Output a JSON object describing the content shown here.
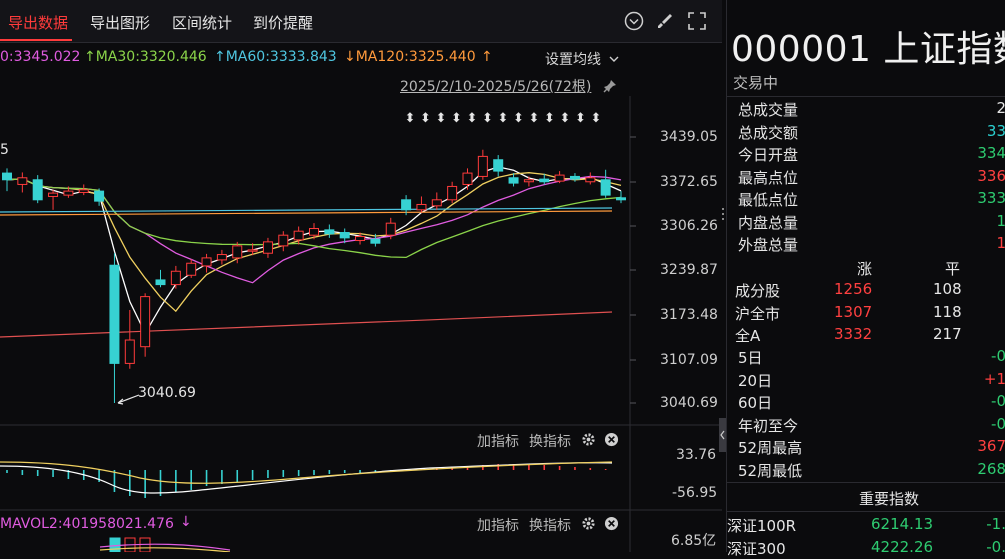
{
  "toolbar": {
    "tabs": [
      "导出数据",
      "导出图形",
      "区间统计",
      "到价提醒"
    ]
  },
  "ma_bar": {
    "ma_first": "0:3345.022",
    "ma30": "↑MA30:3320.446",
    "ma60": "↑MA60:3333.843",
    "ma120": "↓MA120:3325.440",
    "ma120_arrow": "↑",
    "settings": "设置均线"
  },
  "range_label": "2025/2/10-2025/5/26(72根)",
  "main_chart": {
    "y_ticks": [
      "3439.05",
      "3372.65",
      "3306.26",
      "3239.87",
      "3173.48",
      "3107.09",
      "3040.69"
    ],
    "low_annotation": "3040.69",
    "left_partial_label": "5"
  },
  "indicator1": {
    "add_label": "加指标",
    "switch_label": "换指标",
    "y_ticks": [
      "33.76",
      "-56.95"
    ]
  },
  "indicator2": {
    "title": "MAVOL2:401958021.476",
    "arrow": "↓",
    "add_label": "加指标",
    "switch_label": "换指标",
    "y_tick": "6.85亿"
  },
  "right_panel": {
    "code": "000001",
    "name": "上证指数",
    "status": "交易中",
    "stats": [
      {
        "label": "总成交量",
        "value": "2",
        "color": "white"
      },
      {
        "label": "总成交额",
        "value": "33",
        "color": "cyan"
      },
      {
        "label": "今日开盘",
        "value": "334",
        "color": "green"
      },
      {
        "label": "最高点位",
        "value": "336",
        "color": "red"
      },
      {
        "label": "最低点位",
        "value": "333",
        "color": "green"
      },
      {
        "label": "内盘总量",
        "value": "1",
        "color": "green"
      },
      {
        "label": "外盘总量",
        "value": "1",
        "color": "red"
      }
    ],
    "breadth_headers": [
      "涨",
      "平"
    ],
    "breadth": [
      {
        "label": "成分股",
        "up": "1256",
        "flat": "108"
      },
      {
        "label": "沪全市",
        "up": "1307",
        "flat": "118"
      },
      {
        "label": "全A",
        "up": "3332",
        "flat": "217"
      }
    ],
    "periods": [
      {
        "label": "5日",
        "value": "-0",
        "color": "green"
      },
      {
        "label": "20日",
        "value": "+1",
        "color": "red"
      },
      {
        "label": "60日",
        "value": "-0",
        "color": "green"
      },
      {
        "label": "年初至今",
        "value": "-0",
        "color": "green"
      },
      {
        "label": "52周最高",
        "value": "367",
        "color": "red"
      },
      {
        "label": "52周最低",
        "value": "268",
        "color": "green"
      }
    ],
    "important_title": "重要指数",
    "indices": [
      {
        "name": "深证100R",
        "value": "6214.13",
        "change": "-1."
      },
      {
        "name": "深证300",
        "value": "4222.26",
        "change": "-0."
      }
    ]
  },
  "candles": [
    {
      "o": 3385,
      "c": 3375,
      "h": 3392,
      "l": 3358
    },
    {
      "o": 3368,
      "c": 3378,
      "h": 3386,
      "l": 3356
    },
    {
      "o": 3375,
      "c": 3345,
      "h": 3382,
      "l": 3340
    },
    {
      "o": 3350,
      "c": 3355,
      "h": 3360,
      "l": 3330
    },
    {
      "o": 3352,
      "c": 3358,
      "h": 3365,
      "l": 3348
    },
    {
      "o": 3356,
      "c": 3360,
      "h": 3368,
      "l": 3352
    },
    {
      "o": 3358,
      "c": 3343,
      "h": 3362,
      "l": 3336
    },
    {
      "o": 3247,
      "c": 3100,
      "h": 3265,
      "l": 3040.69
    },
    {
      "o": 3100,
      "c": 3135,
      "h": 3180,
      "l": 3092
    },
    {
      "o": 3125,
      "c": 3200,
      "h": 3205,
      "l": 3110
    },
    {
      "o": 3225,
      "c": 3218,
      "h": 3240,
      "l": 3214
    },
    {
      "o": 3218,
      "c": 3238,
      "h": 3246,
      "l": 3212
    },
    {
      "o": 3232,
      "c": 3250,
      "h": 3256,
      "l": 3228
    },
    {
      "o": 3246,
      "c": 3258,
      "h": 3264,
      "l": 3236
    },
    {
      "o": 3255,
      "c": 3263,
      "h": 3270,
      "l": 3248
    },
    {
      "o": 3258,
      "c": 3276,
      "h": 3282,
      "l": 3250
    },
    {
      "o": 3268,
      "c": 3270,
      "h": 3280,
      "l": 3262
    },
    {
      "o": 3265,
      "c": 3282,
      "h": 3288,
      "l": 3258
    },
    {
      "o": 3276,
      "c": 3292,
      "h": 3298,
      "l": 3268
    },
    {
      "o": 3285,
      "c": 3298,
      "h": 3305,
      "l": 3278
    },
    {
      "o": 3292,
      "c": 3302,
      "h": 3310,
      "l": 3286
    },
    {
      "o": 3300,
      "c": 3294,
      "h": 3308,
      "l": 3288
    },
    {
      "o": 3296,
      "c": 3288,
      "h": 3302,
      "l": 3280
    },
    {
      "o": 3284,
      "c": 3290,
      "h": 3296,
      "l": 3278
    },
    {
      "o": 3286,
      "c": 3280,
      "h": 3294,
      "l": 3275
    },
    {
      "o": 3292,
      "c": 3310,
      "h": 3318,
      "l": 3286
    },
    {
      "o": 3345,
      "c": 3330,
      "h": 3352,
      "l": 3322
    },
    {
      "o": 3330,
      "c": 3338,
      "h": 3350,
      "l": 3326
    },
    {
      "o": 3336,
      "c": 3345,
      "h": 3356,
      "l": 3330
    },
    {
      "o": 3345,
      "c": 3365,
      "h": 3372,
      "l": 3340
    },
    {
      "o": 3368,
      "c": 3385,
      "h": 3392,
      "l": 3360
    },
    {
      "o": 3380,
      "c": 3410,
      "h": 3420,
      "l": 3375
    },
    {
      "o": 3405,
      "c": 3388,
      "h": 3412,
      "l": 3380
    },
    {
      "o": 3378,
      "c": 3370,
      "h": 3385,
      "l": 3365
    },
    {
      "o": 3372,
      "c": 3375,
      "h": 3380,
      "l": 3365
    },
    {
      "o": 3376,
      "c": 3372,
      "h": 3384,
      "l": 3368
    },
    {
      "o": 3373,
      "c": 3382,
      "h": 3388,
      "l": 3370
    },
    {
      "o": 3380,
      "c": 3376,
      "h": 3385,
      "l": 3372
    },
    {
      "o": 3372,
      "c": 3378,
      "h": 3386,
      "l": 3368
    },
    {
      "o": 3375,
      "c": 3352,
      "h": 3390,
      "l": 3348
    },
    {
      "o": 3348,
      "c": 3345,
      "h": 3358,
      "l": 3340
    }
  ]
}
